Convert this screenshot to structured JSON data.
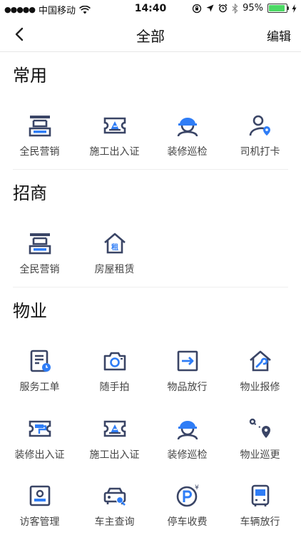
{
  "status_bar": {
    "signal": "●●●●●",
    "carrier": "中国移动",
    "time": "14:40",
    "battery_percent": "95%",
    "battery_level": 0.95
  },
  "nav": {
    "title": "全部",
    "edit": "编辑"
  },
  "sections": [
    {
      "title": "常用",
      "rows": [
        [
          {
            "label": "全民营销",
            "icon": "marketing-icon"
          },
          {
            "label": "施工出入证",
            "icon": "construction-pass-icon"
          },
          {
            "label": "装修巡检",
            "icon": "worker-helmet-icon"
          },
          {
            "label": "司机打卡",
            "icon": "driver-checkin-icon"
          }
        ]
      ]
    },
    {
      "title": "招商",
      "rows": [
        [
          {
            "label": "全民营销",
            "icon": "marketing-icon"
          },
          {
            "label": "房屋租赁",
            "icon": "house-rent-icon",
            "badge": "租"
          }
        ]
      ]
    },
    {
      "title": "物业",
      "rows": [
        [
          {
            "label": "服务工单",
            "icon": "work-order-icon"
          },
          {
            "label": "随手拍",
            "icon": "camera-icon"
          },
          {
            "label": "物品放行",
            "icon": "item-release-icon"
          },
          {
            "label": "物业报修",
            "icon": "repair-house-icon"
          }
        ],
        [
          {
            "label": "装修出入证",
            "icon": "renovation-pass-icon"
          },
          {
            "label": "施工出入证",
            "icon": "construction-pass-icon"
          },
          {
            "label": "装修巡检",
            "icon": "worker-helmet-icon"
          },
          {
            "label": "物业巡更",
            "icon": "patrol-route-icon"
          }
        ],
        [
          {
            "label": "访客管理",
            "icon": "visitor-icon"
          },
          {
            "label": "车主查询",
            "icon": "car-search-icon"
          },
          {
            "label": "停车收费",
            "icon": "parking-fee-icon",
            "badge": "¥"
          },
          {
            "label": "车辆放行",
            "icon": "bus-release-icon"
          }
        ]
      ]
    }
  ],
  "colors": {
    "icon_dark": "#3a4566",
    "icon_blue": "#2f7df6"
  }
}
